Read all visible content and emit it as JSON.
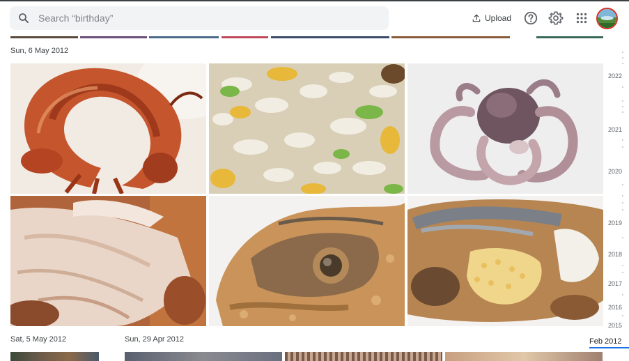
{
  "search": {
    "placeholder": "Search “birthday”"
  },
  "toolbar": {
    "upload_label": "Upload"
  },
  "groups": [
    {
      "date": "Sun, 6 May 2012"
    },
    {
      "date": "Sat, 5 May 2012"
    },
    {
      "date": "Sun, 29 Apr 2012"
    }
  ],
  "photos": [
    {
      "subject": "grilled prawn"
    },
    {
      "subject": "fried rice"
    },
    {
      "subject": "baby octopus"
    },
    {
      "subject": "roast meat"
    },
    {
      "subject": "fried fish"
    },
    {
      "subject": "fried fish with roe"
    }
  ],
  "timeline": {
    "years": [
      "2022",
      "2021",
      "2020",
      "2019",
      "2018",
      "2017",
      "2016",
      "2015"
    ],
    "current": "Feb 2012"
  },
  "colors": {
    "accent": "#1a73e8",
    "avatar_ring": "#d93025"
  }
}
